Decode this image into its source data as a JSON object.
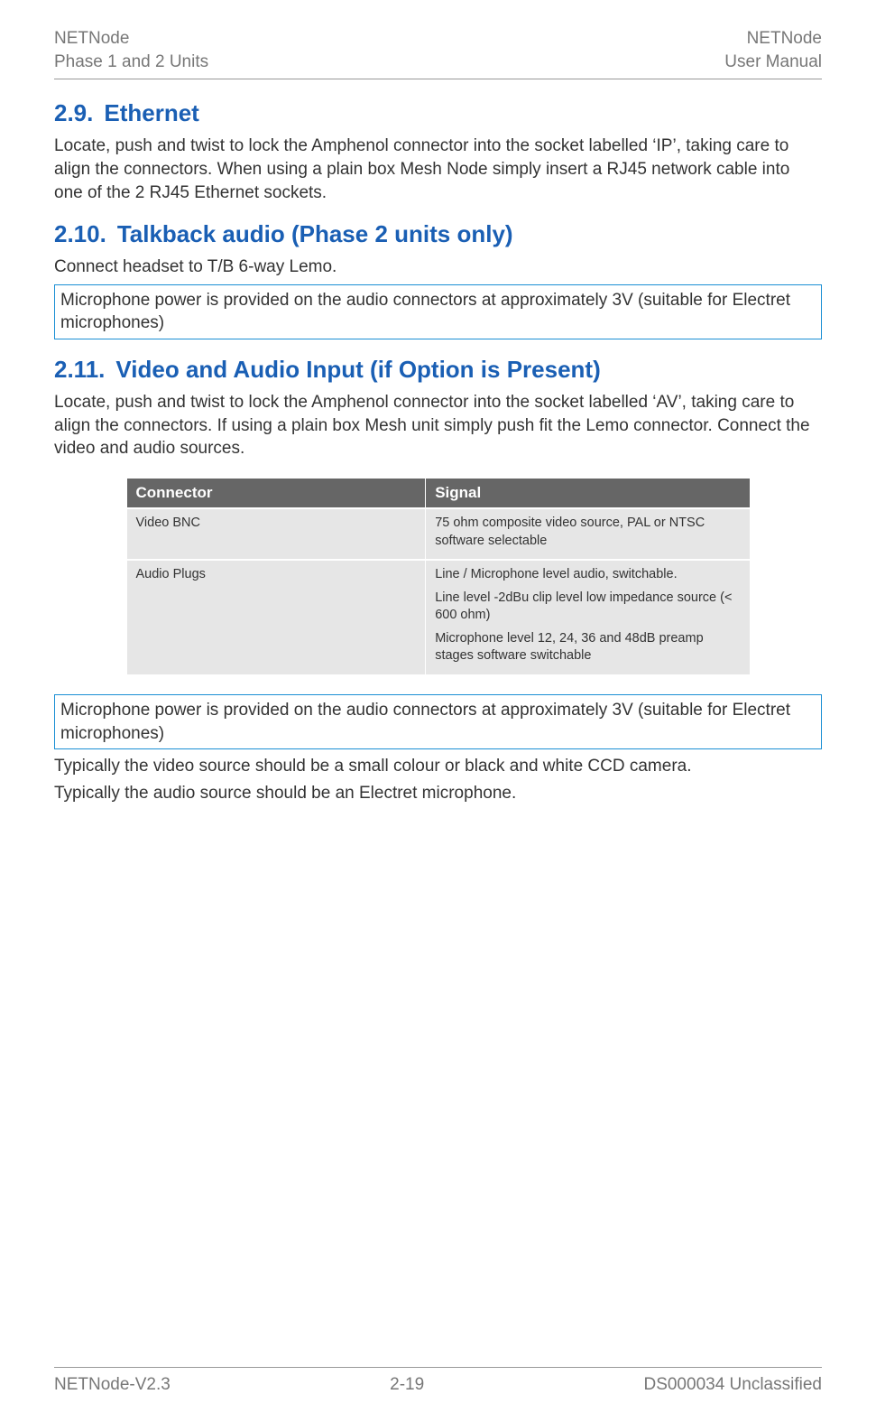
{
  "header": {
    "left_line1": "NETNode",
    "left_line2": "Phase 1 and 2 Units",
    "right_line1": "NETNode",
    "right_line2": "User Manual"
  },
  "sections": {
    "s29": {
      "num": "2.9.",
      "title": "Ethernet",
      "body": "Locate, push and twist to lock the Amphenol connector into the socket labelled ‘IP’, taking care to align the connectors. When using a plain box Mesh Node simply insert a RJ45 network cable into one of the 2 RJ45 Ethernet sockets."
    },
    "s210": {
      "num": "2.10.",
      "title": "Talkback audio (Phase 2 units only)",
      "body": "Connect headset to T/B 6-way Lemo.",
      "note": "Microphone power is provided on the audio connectors at approximately 3V (suitable for Electret microphones)"
    },
    "s211": {
      "num": "2.11.",
      "title": "Video and Audio Input (if Option is Present)",
      "body": "Locate, push and twist to lock the Amphenol connector into the socket labelled ‘AV’, taking care to align the connectors. If using a plain box Mesh unit simply push fit the Lemo connector. Connect the video and audio sources.",
      "note": "Microphone power is provided on the audio connectors at approximately 3V (suitable for Electret microphones)",
      "after1": "Typically the video source should be a small colour or black and white CCD camera.",
      "after2": "Typically the audio source should be an Electret microphone."
    }
  },
  "table": {
    "headers": {
      "c1": "Connector",
      "c2": "Signal"
    },
    "rows": [
      {
        "c1": "Video BNC",
        "c2_p1": "75 ohm composite video source, PAL or NTSC software selectable"
      },
      {
        "c1": "Audio Plugs",
        "c2_p1": "Line / Microphone level audio, switchable.",
        "c2_p2": "Line level -2dBu clip level low impedance source (< 600 ohm)",
        "c2_p3": "Microphone level 12, 24, 36 and 48dB preamp stages software switchable"
      }
    ]
  },
  "footer": {
    "left": "NETNode-V2.3",
    "center": "2-19",
    "right": "DS000034 Unclassified"
  }
}
